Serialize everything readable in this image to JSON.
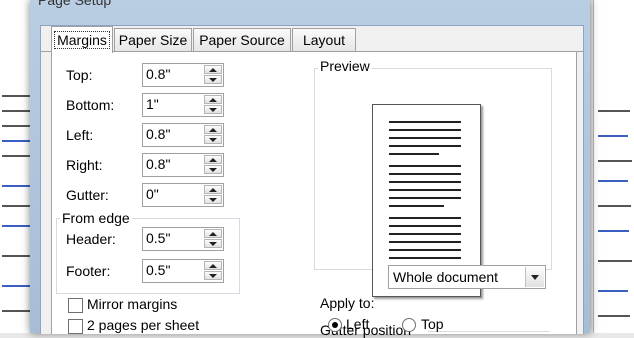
{
  "window": {
    "title": "Page Setup"
  },
  "tabs": [
    {
      "label": "Margins",
      "active": true
    },
    {
      "label": "Paper Size",
      "active": false
    },
    {
      "label": "Paper Source",
      "active": false
    },
    {
      "label": "Layout",
      "active": false
    }
  ],
  "margins": {
    "top": {
      "label": "Top:",
      "value": "0.8\""
    },
    "bottom": {
      "label": "Bottom:",
      "value": "1\""
    },
    "left": {
      "label": "Left:",
      "value": "0.8\""
    },
    "right": {
      "label": "Right:",
      "value": "0.8\""
    },
    "gutter": {
      "label": "Gutter:",
      "value": "0\""
    }
  },
  "from_edge": {
    "title": "From edge",
    "header": {
      "label": "Header:",
      "value": "0.5\""
    },
    "footer": {
      "label": "Footer:",
      "value": "0.5\""
    }
  },
  "options": {
    "mirror_margins": {
      "label": "Mirror margins",
      "checked": false
    },
    "two_pages": {
      "label": "2 pages per sheet",
      "checked": false
    }
  },
  "preview": {
    "title": "Preview"
  },
  "apply_to": {
    "label": "Apply to:",
    "value": "Whole document"
  },
  "gutter_position": {
    "title": "Gutter position",
    "left": {
      "label": "Left",
      "selected": true
    },
    "top": {
      "label": "Top",
      "selected": false
    }
  }
}
